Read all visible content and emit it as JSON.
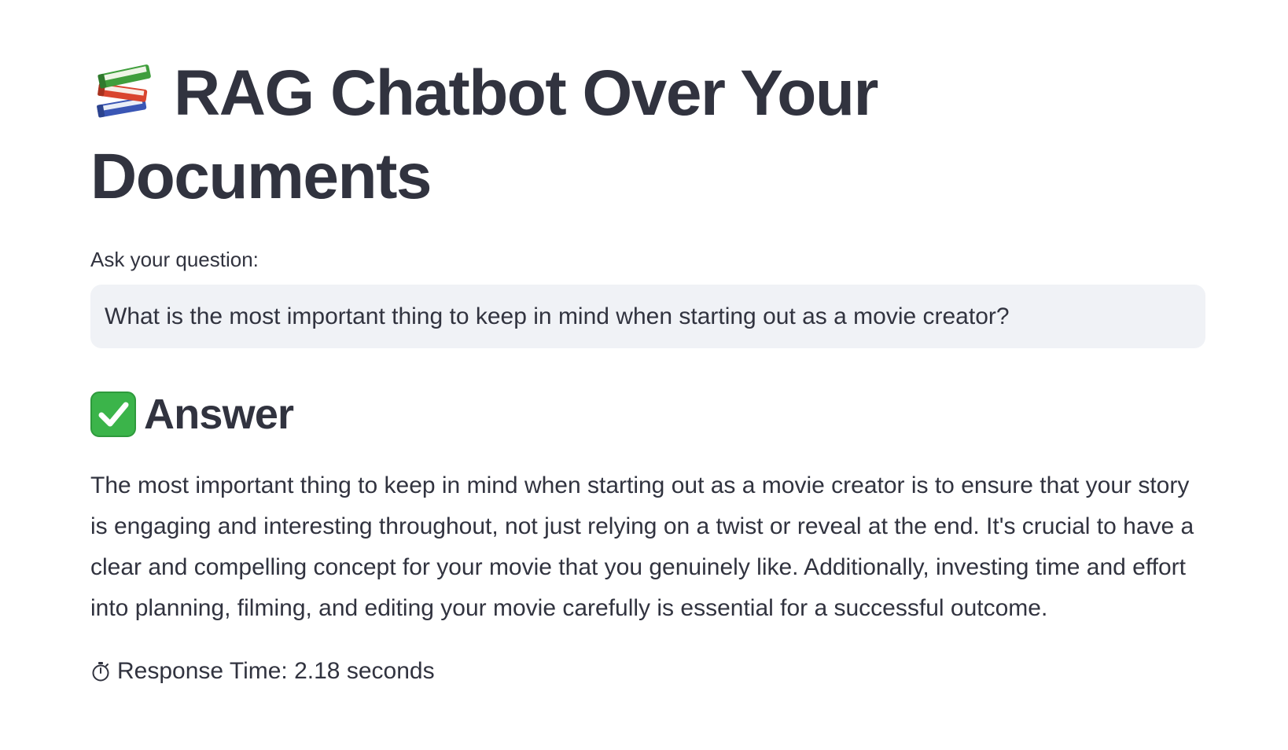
{
  "header": {
    "title_icon": "books-icon",
    "title": "RAG Chatbot Over Your Documents"
  },
  "query": {
    "label": "Ask your question:",
    "value": "What is the most important thing to keep in mind when starting out as a movie creator?"
  },
  "answer": {
    "heading_icon": "check-mark-icon",
    "heading": "Answer",
    "text": "The most important thing to keep in mind when starting out as a movie creator is to ensure that your story is engaging and interesting throughout, not just relying on a twist or reveal at the end. It's crucial to have a clear and compelling concept for your movie that you genuinely like. Additionally, investing time and effort into planning, filming, and editing your movie carefully is essential for a successful outcome."
  },
  "metrics": {
    "icon": "stopwatch-icon",
    "response_time": "Response Time: 2.18 seconds"
  },
  "colors": {
    "text": "#31333f",
    "input_background": "#f0f2f6",
    "check_green": "#3bb44a"
  }
}
